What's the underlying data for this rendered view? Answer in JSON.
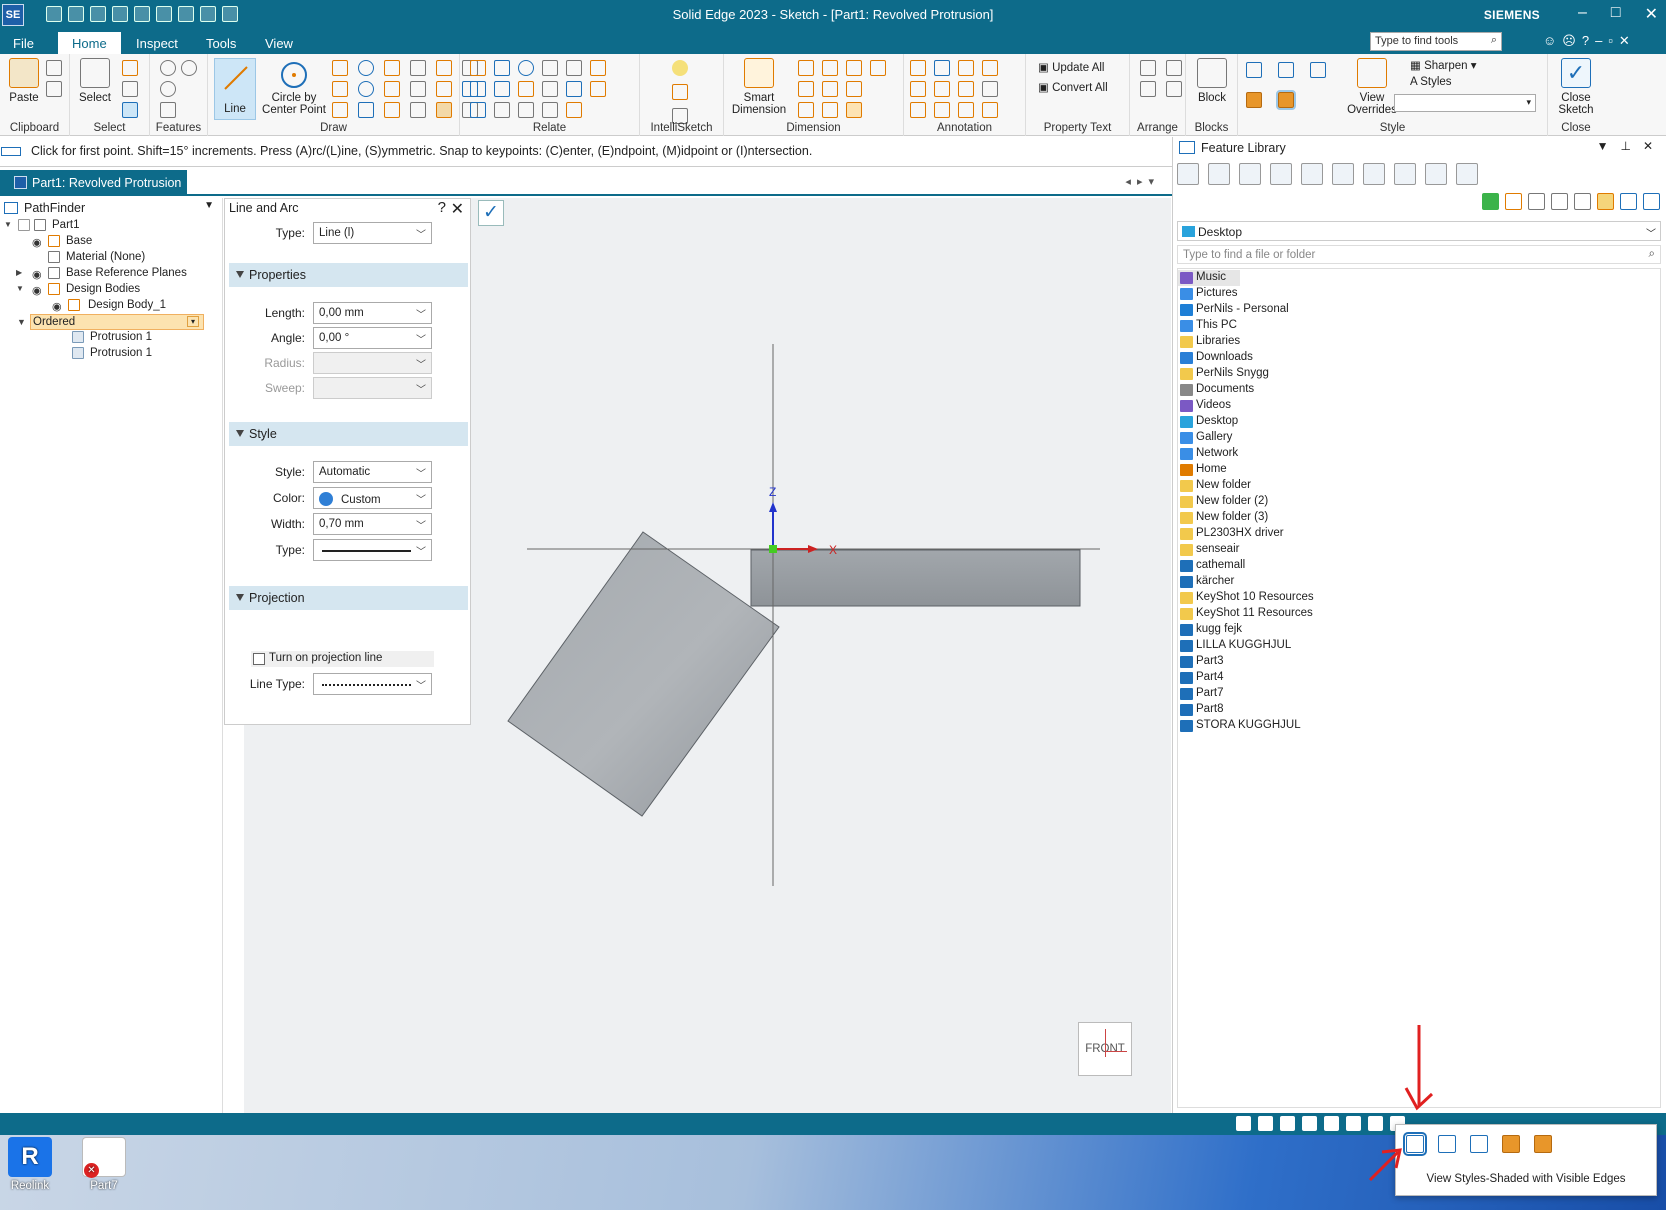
{
  "window": {
    "title": "Solid Edge 2023 - Sketch - [Part1: Revolved Protrusion]",
    "brand": "SIEMENS",
    "logo": "SE",
    "controls": [
      "–",
      "□",
      "✕"
    ]
  },
  "menu": {
    "tabs": [
      "File",
      "Home",
      "Inspect",
      "Tools",
      "View"
    ],
    "active": "Home",
    "find_tools_placeholder": "Type to find tools"
  },
  "ribbon": {
    "groups": {
      "clipboard": "Clipboard",
      "select": "Select",
      "features": "Features",
      "draw": "Draw",
      "relate": "Relate",
      "intellisketch": "IntelliSketch",
      "dimension": "Dimension",
      "annotation": "Annotation",
      "property_text": "Property Text",
      "arrange": "Arrange",
      "blocks": "Blocks",
      "style": "Style",
      "close": "Close"
    },
    "paste": "Paste",
    "select_btn": "Select",
    "line": "Line",
    "circle_l1": "Circle by",
    "circle_l2": "Center Point",
    "smart_l1": "Smart",
    "smart_l2": "Dimension",
    "update_all": "Update All",
    "convert_all": "Convert All",
    "block": "Block",
    "view_l1": "View",
    "view_l2": "Overrides",
    "sharpen": "Sharpen",
    "styles": "Styles",
    "close_l1": "Close",
    "close_l2": "Sketch"
  },
  "prompt": "Click for first point.  Shift=15° increments. Press (A)rc/(L)ine, (S)ymmetric. Snap to keypoints: (C)enter, (E)ndpoint, (M)idpoint or (I)ntersection.",
  "doc_tab": "Part1: Revolved Protrusion",
  "pathfinder": {
    "title": "PathFinder",
    "tree": [
      "Part1",
      "Base",
      "Material (None)",
      "Base Reference Planes",
      "Design Bodies",
      "Design Body_1",
      "Ordered",
      "Protrusion 1",
      "Protrusion 1"
    ]
  },
  "line_arc": {
    "title": "Line and Arc",
    "help": "?",
    "close": "✕",
    "type_label": "Type:",
    "type_value": "Line (l)",
    "properties": "Properties",
    "length_label": "Length:",
    "length_value": "0,00 mm",
    "angle_label": "Angle:",
    "angle_value": "0,00 °",
    "radius_label": "Radius:",
    "sweep_label": "Sweep:",
    "style_section": "Style",
    "style_label": "Style:",
    "style_value": "Automatic",
    "color_label": "Color:",
    "color_value": "Custom",
    "width_label": "Width:",
    "width_value": "0,70 mm",
    "linetype_label": "Type:",
    "projection": "Projection",
    "projection_check": "Turn on projection line",
    "projection_linetype_label": "Line Type:"
  },
  "canvas": {
    "axis_z": "Z",
    "axis_x": "X",
    "view_cube": "FRONT"
  },
  "feature_library": {
    "title": "Feature Library",
    "location": "Desktop",
    "find_placeholder": "Type to find a file or folder",
    "items": [
      "Music",
      "Pictures",
      "PerNils - Personal",
      "This PC",
      "Libraries",
      "Downloads",
      "PerNils Snygg",
      "Documents",
      "Videos",
      "Desktop",
      "Gallery",
      "Network",
      "Home",
      "New folder",
      "New folder (2)",
      "New folder (3)",
      "PL2303HX driver",
      "senseair",
      "cathemall",
      "kärcher",
      "KeyShot 10 Resources",
      "KeyShot 11 Resources",
      "kugg fejk",
      "LILLA KUGGHJUL",
      "Part3",
      "Part4",
      "Part7",
      "Part8",
      "STORA KUGGHJUL"
    ]
  },
  "taskbar": {
    "apps": [
      "Reolink",
      "Part7"
    ]
  },
  "view_styles_popup": {
    "caption": "View Styles-Shaded with Visible Edges"
  },
  "colors": {
    "accent": "#0d6b8a",
    "selection": "#fce3b0",
    "annotation_red": "#e02020"
  }
}
